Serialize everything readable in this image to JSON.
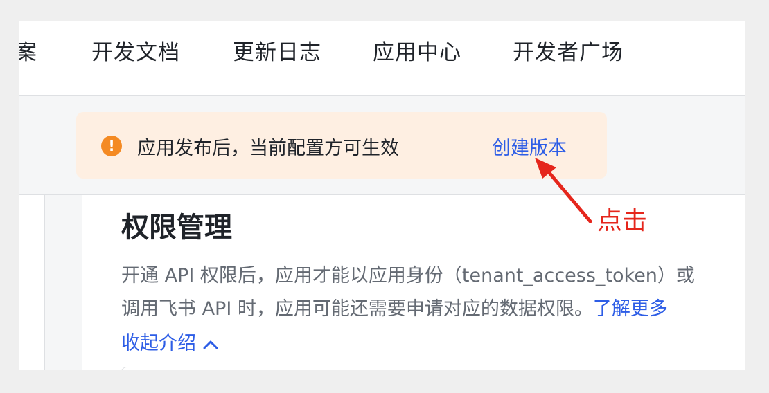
{
  "topnav": {
    "items": [
      {
        "label": "案"
      },
      {
        "label": "开发文档"
      },
      {
        "label": "更新日志"
      },
      {
        "label": "应用中心"
      },
      {
        "label": "开发者广场"
      }
    ]
  },
  "alert": {
    "icon": "warning-icon",
    "text": "应用发布后，当前配置方可生效",
    "link": "创建版本",
    "colors": {
      "background": "#feefe2",
      "icon": "#f48a23",
      "link": "#2d5de6"
    }
  },
  "section": {
    "title": "权限管理",
    "desc_line1": "开通 API 权限后，应用才能以应用身份（tenant_access_token）或",
    "desc_line2": "调用飞书 API 时，应用可能还需要申请对应的数据权限。",
    "learn_more": "了解更多",
    "collapse": "收起介绍",
    "collapse_icon": "chevron-up-icon"
  },
  "annotation": {
    "text": "点击",
    "color": "#e5261c"
  }
}
